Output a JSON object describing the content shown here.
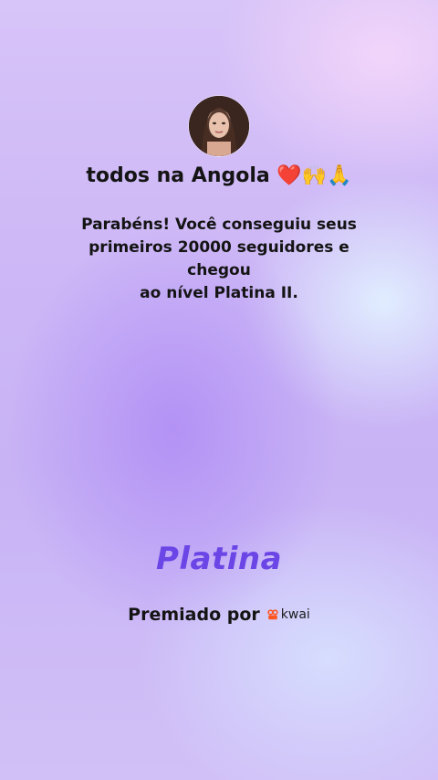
{
  "profile": {
    "name": "todos na Angola",
    "emojis": "❤️🙌🙏"
  },
  "message": {
    "line1": "Parabéns! Você conseguiu seus",
    "line2": "primeiros 20000 seguidores e chegou",
    "line3": "ao nível Platina II."
  },
  "level": {
    "name": "Platina"
  },
  "award": {
    "label": "Premiado por",
    "brand": "kwai",
    "brand_icon": "kwai-logo-icon",
    "brand_color": "#ff5722"
  },
  "colors": {
    "accent": "#6b45e6",
    "text": "#141414"
  }
}
